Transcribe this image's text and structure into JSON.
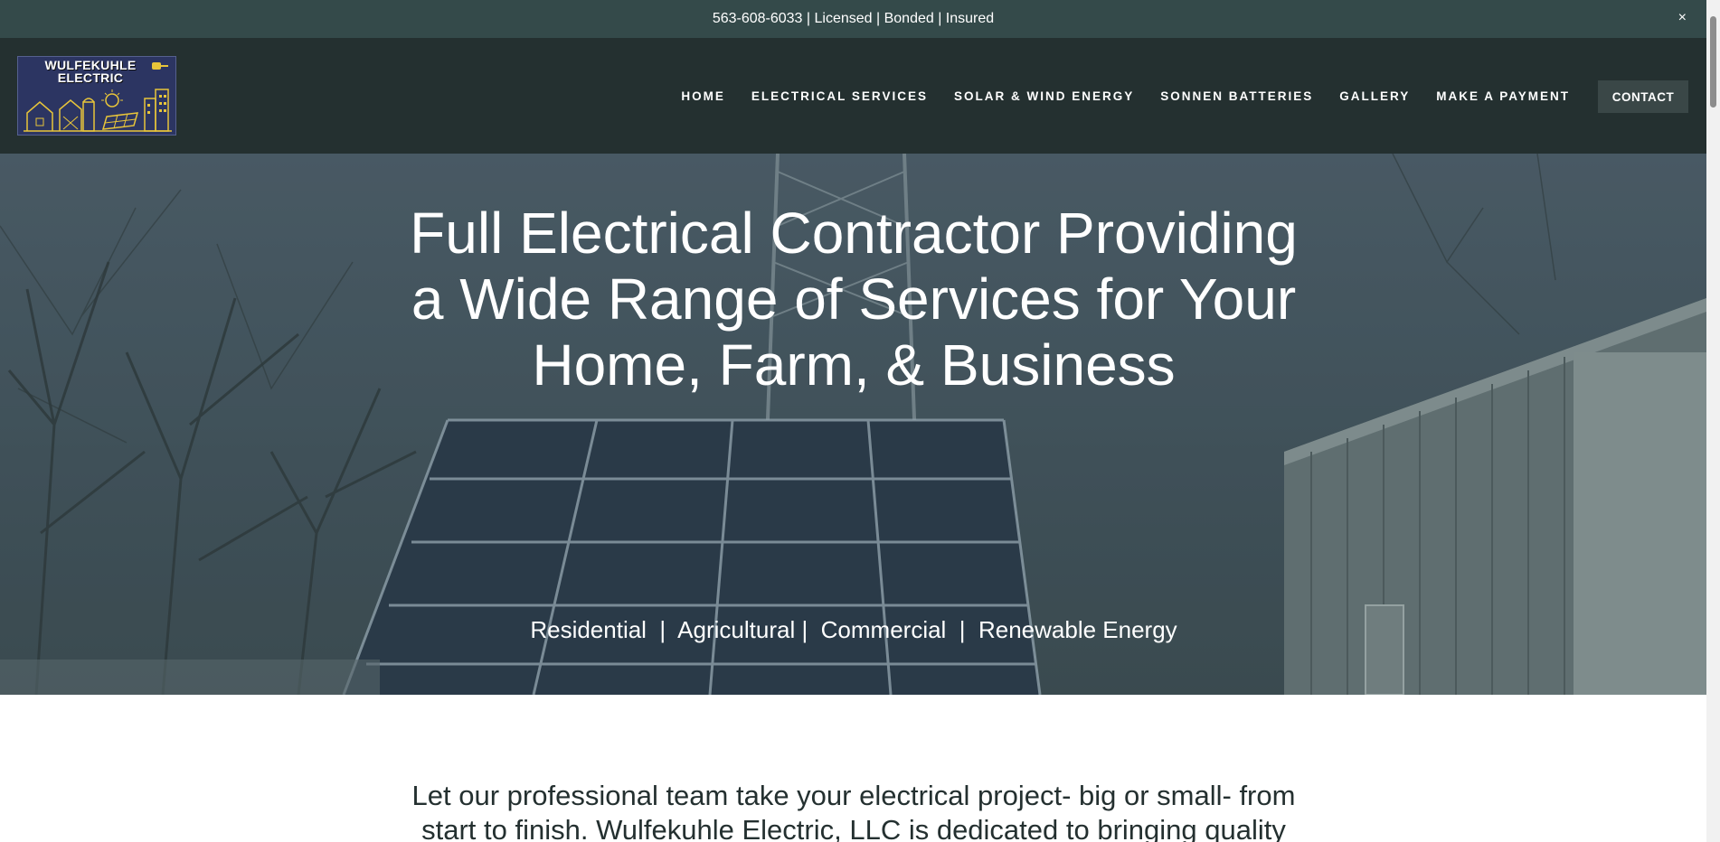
{
  "announcement": {
    "text": "563-608-6033 | Licensed | Bonded | Insured",
    "close_label": "×"
  },
  "header": {
    "logo_line1": "WULFEKUHLE",
    "logo_line2": "ELECTRIC",
    "nav": [
      {
        "label": "HOME"
      },
      {
        "label": "ELECTRICAL SERVICES"
      },
      {
        "label": "SOLAR & WIND ENERGY"
      },
      {
        "label": "SONNEN BATTERIES"
      },
      {
        "label": "GALLERY"
      },
      {
        "label": "MAKE A PAYMENT"
      }
    ],
    "contact_label": "CONTACT"
  },
  "hero": {
    "title": "Full Electrical Contractor Providing a Wide Range of Services for Your Home, Farm, & Business",
    "subtitle": "Residential  |  Agricultural |  Commercial  |  Renewable Energy"
  },
  "intro": {
    "text": "Let our professional team take your electrical project- big or small- from start to finish.  Wulfekuhle Electric, LLC is dedicated to bringing quality"
  },
  "colors": {
    "announcement_bg": "#344a4a",
    "header_bg": "#243030",
    "contact_button_bg": "#3a4747",
    "logo_bg": "#2c3562",
    "logo_accent": "#e8c53a"
  }
}
